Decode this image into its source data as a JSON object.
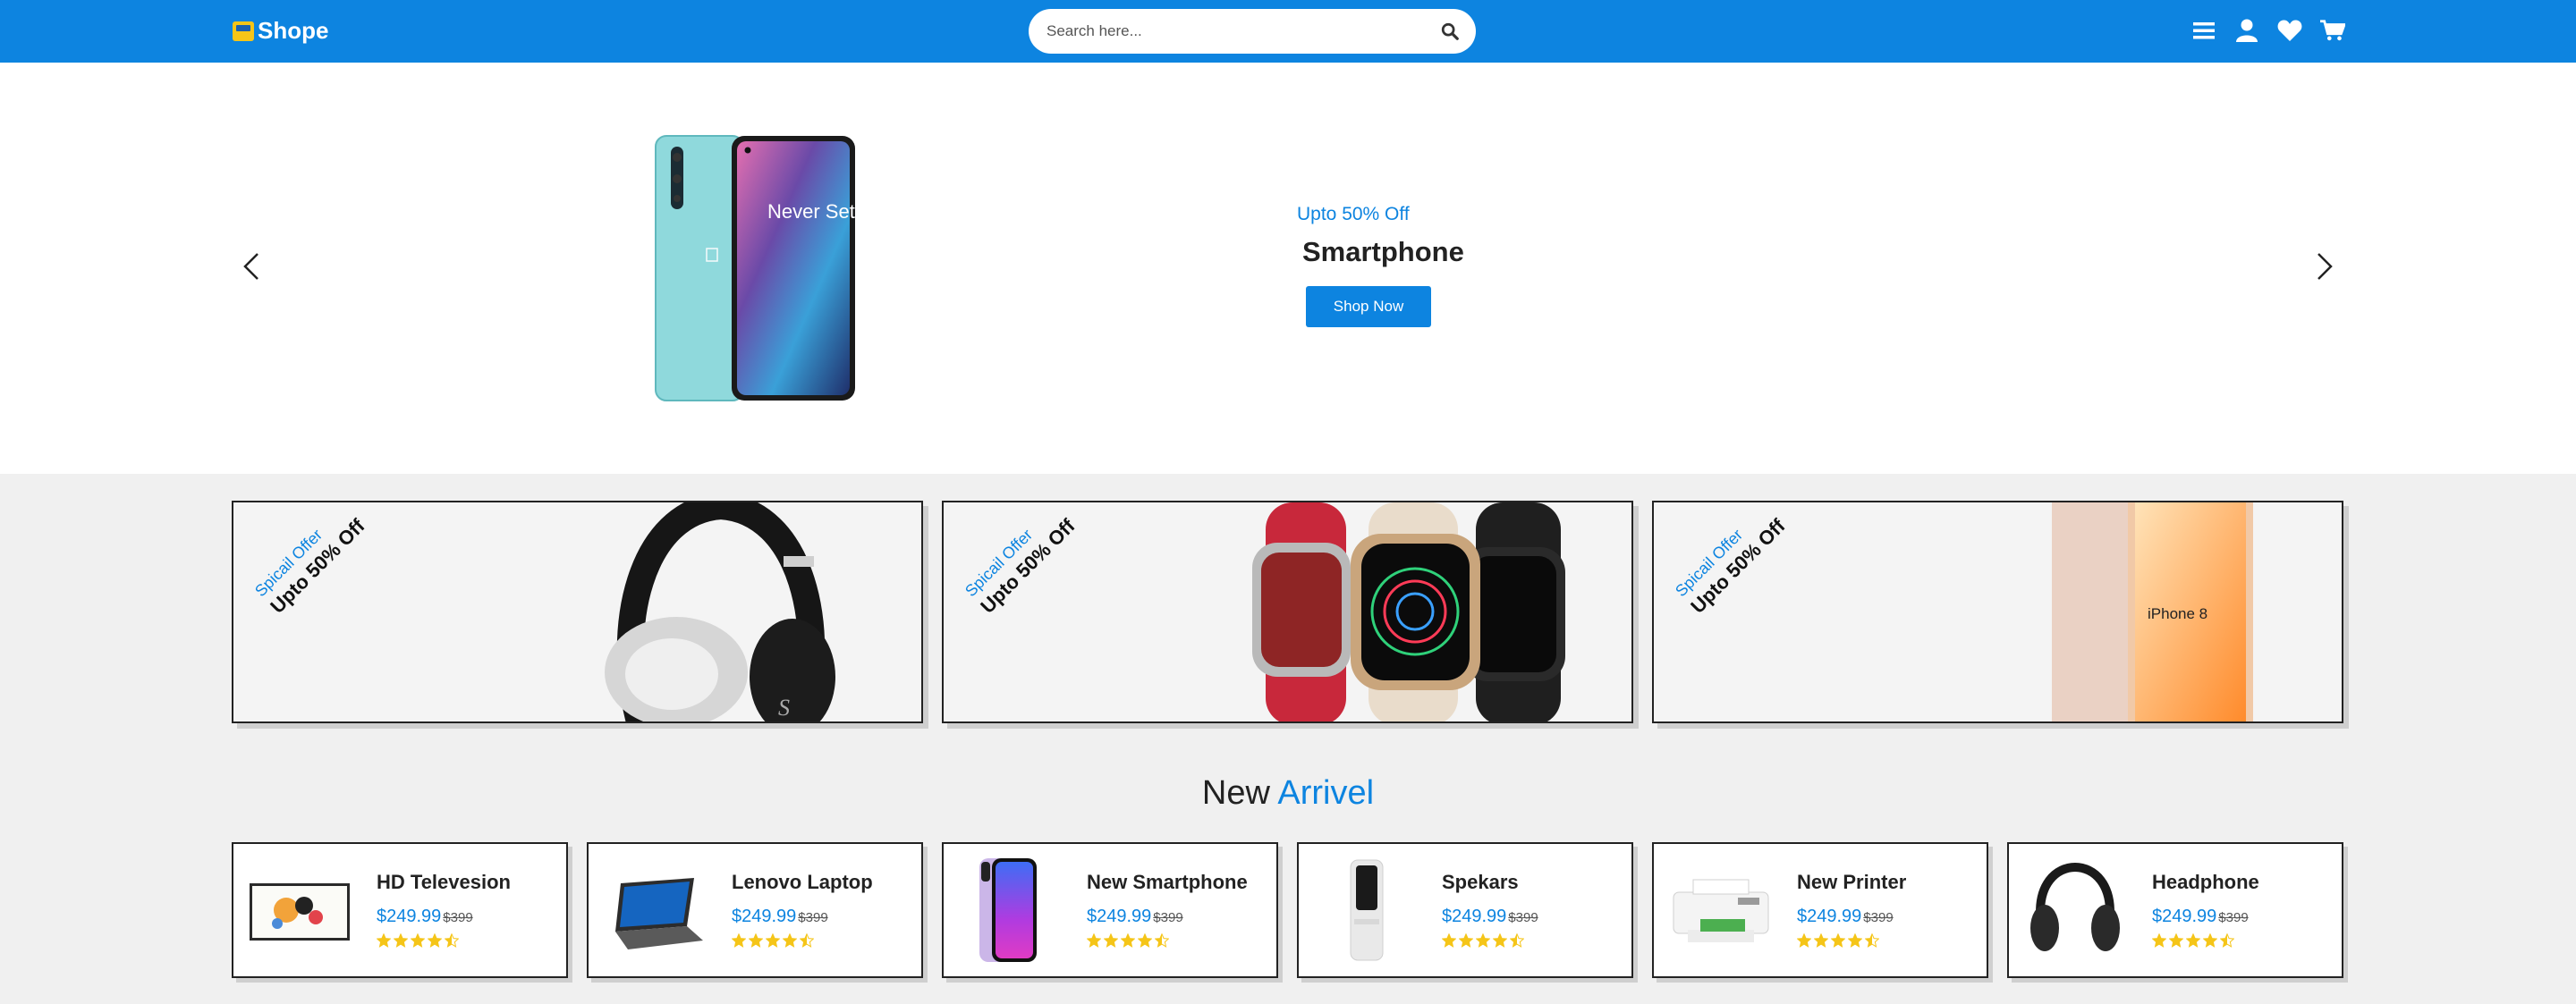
{
  "brand": {
    "name": "Shope"
  },
  "search": {
    "placeholder": "Search here..."
  },
  "nav": {
    "icons": [
      "menu-icon",
      "user-icon",
      "heart-icon",
      "cart-icon"
    ]
  },
  "hero": {
    "offer": "Upto 50% Off",
    "title": "Smartphone",
    "button": "Shop Now",
    "phone_text": "Never Settle"
  },
  "offers": [
    {
      "special": "Spicail Offer",
      "discount": "Upto 50% Off",
      "image": "headphone"
    },
    {
      "special": "Spicail Offer",
      "discount": "Upto 50% Off",
      "image": "smartwatch"
    },
    {
      "special": "Spicail Offer",
      "discount": "Upto 50% Off",
      "image": "iphone",
      "image_text": "iPhone 8"
    }
  ],
  "new_arrival": {
    "title_a": "New",
    "title_b": "Arrivel"
  },
  "products": [
    {
      "name": "HD Televesion",
      "price": "$249.99",
      "old_price": "$399",
      "rating": 4.5
    },
    {
      "name": "Lenovo Laptop",
      "price": "$249.99",
      "old_price": "$399",
      "rating": 4.5
    },
    {
      "name": "New Smartphone",
      "price": "$249.99",
      "old_price": "$399",
      "rating": 4.5
    },
    {
      "name": "Spekars",
      "price": "$249.99",
      "old_price": "$399",
      "rating": 4.5
    },
    {
      "name": "New Printer",
      "price": "$249.99",
      "old_price": "$399",
      "rating": 4.5
    },
    {
      "name": "Headphone",
      "price": "$249.99",
      "old_price": "$399",
      "rating": 4.5
    }
  ],
  "colors": {
    "primary": "#0d84e0",
    "star": "#f5c518",
    "accent": "#f5c518"
  }
}
